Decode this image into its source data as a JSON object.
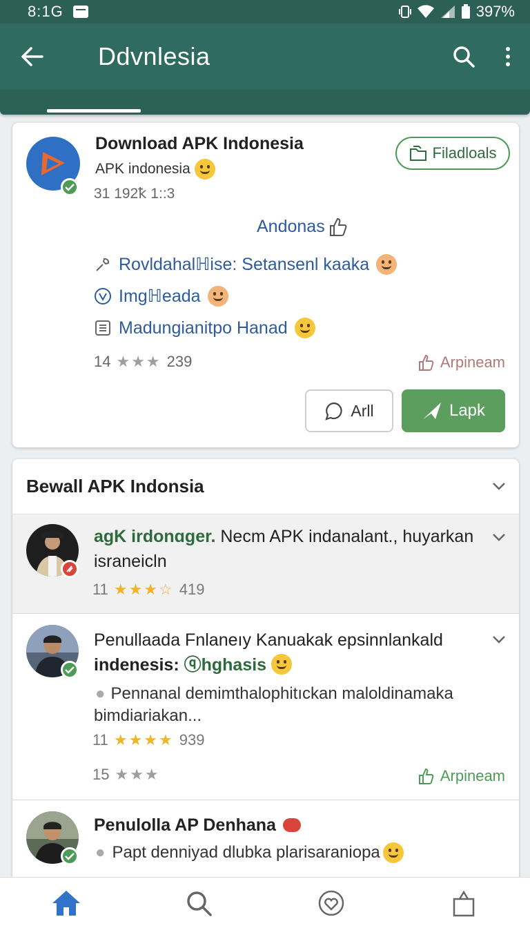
{
  "status_bar": {
    "time": "8:1G",
    "battery": "397%"
  },
  "app_bar": {
    "title": "Ddvnlesia"
  },
  "app_card": {
    "title": "Download APK Indonesia",
    "subtitle": "APK indonesia",
    "meta": "31 192ꝁ 1::3",
    "files_label": "Filadloals",
    "android_label": "Andonas",
    "features": [
      {
        "icon": "wrench-icon",
        "label": "Rovldahalℍise: Setansenl kaaka"
      },
      {
        "icon": "shield-icon",
        "label": "Imgℍeada"
      },
      {
        "icon": "list-icon",
        "label": "Madungianitpo Hanad"
      }
    ],
    "rating_count": "14",
    "stars": "★★★",
    "rating_extra": "239",
    "premium_label": "Arpineam",
    "all_button": "Arll",
    "primary_button": "Lapk",
    "colors": {
      "accent": "#5b9e5e",
      "link": "#2d5b9e"
    }
  },
  "reviews_section": {
    "title": "Bewall APK Indonsia",
    "items": [
      {
        "title_prefix": "agK irdonɑɡer.",
        "title_rest": "Necm APK indanalant., huyarkan israneicln",
        "rating_count": "11",
        "stars": "★★★☆",
        "rating_extra": "419"
      },
      {
        "title": "Penullaada Fnlaneıy Kanuakak epsinnlankald",
        "title_line2": "indenesis:",
        "handle": "ⓠhghasis",
        "body": "Pennanal demimthalophitıckan maloldinamaka bimdiariakan...",
        "rating_count": "11",
        "stars": "★★★★",
        "rating_extra": "939",
        "rating2_count": "15",
        "stars2": "★★★",
        "premium_label": "Arpineam"
      },
      {
        "title": "Penulolla AP Denhana",
        "body": "Papt denniyad  dlubka plarisaraniopa"
      }
    ]
  },
  "bottom_nav": [
    "home-icon",
    "search-icon",
    "heart-icon",
    "bag-icon"
  ]
}
